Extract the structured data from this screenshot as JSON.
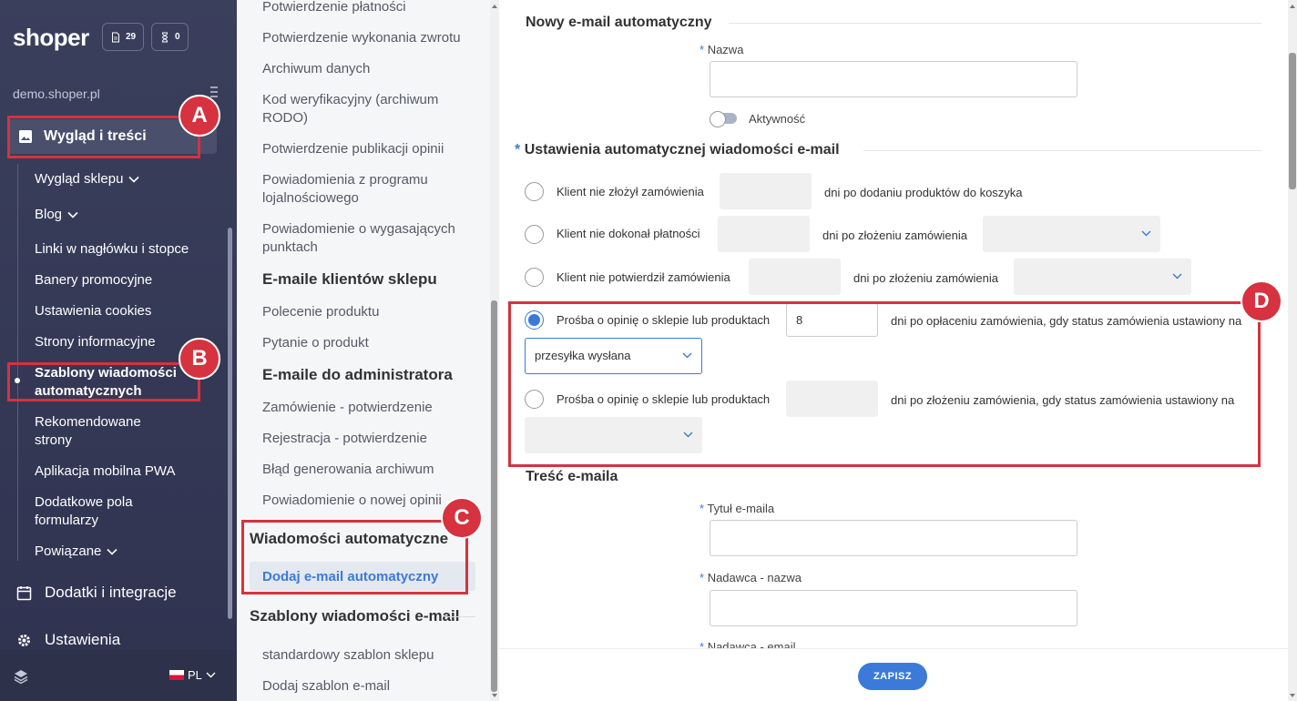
{
  "sidebar": {
    "logo": "shoper",
    "badge_orders": "29",
    "badge_tasks": "0",
    "shop_url": "demo.shoper.pl",
    "active_section": "Wygląd i treści",
    "sub_items": [
      {
        "label": "Wygląd sklepu"
      },
      {
        "label": "Blog"
      },
      {
        "label": "Linki w nagłówku i stopce"
      },
      {
        "label": "Banery promocyjne"
      },
      {
        "label": "Ustawienia cookies"
      },
      {
        "label": "Strony informacyjne"
      },
      {
        "label": "Szablony wiadomości automatycznych"
      },
      {
        "label": "Rekomendowane strony"
      },
      {
        "label": "Aplikacja mobilna PWA"
      },
      {
        "label": "Dodatkowe pola formularzy"
      },
      {
        "label": "Powiązane"
      }
    ],
    "main_items": [
      {
        "label": "Dodatki i integracje",
        "icon": "calendar-icon"
      },
      {
        "label": "Ustawienia",
        "icon": "gear-icon"
      }
    ],
    "language": "PL"
  },
  "middle": {
    "items_top": [
      "Potwierdzenie płatności",
      "Potwierdzenie wykonania zwrotu",
      "Archiwum danych",
      "Kod weryfikacyjny (archiwum RODO)",
      "Potwierdzenie publikacji opinii",
      "Powiadomienia z programu lojalnościowego",
      "Powiadomienie o wygasających punktach"
    ],
    "head_clients": "E-maile klientów sklepu",
    "items_clients": [
      "Polecenie produktu",
      "Pytanie o produkt"
    ],
    "head_admin": "E-maile do administratora",
    "items_admin": [
      "Zamówienie - potwierdzenie",
      "Rejestracja - potwierdzenie",
      "Błąd generowania archiwum",
      "Powiadomienie o nowej opinii"
    ],
    "head_auto": "Wiadomości automatyczne",
    "active_item": "Dodaj e-mail automatyczny",
    "head_templates": "Szablony wiadomości e-mail",
    "items_templates": [
      "standardowy szablon sklepu",
      "Dodaj szablon e-mail"
    ]
  },
  "form": {
    "section_new": "Nowy e-mail automatyczny",
    "name_label": "Nazwa",
    "active_label": "Aktywność",
    "section_settings": "Ustawienia automatycznej wiadomości e-mail",
    "options": [
      {
        "label": "Klient nie złożył zamówienia",
        "suffix": "dni po dodaniu produktów do koszyka",
        "value": ""
      },
      {
        "label": "Klient nie dokonał płatności",
        "suffix": "dni po złożeniu zamówienia",
        "value": ""
      },
      {
        "label": "Klient nie potwierdził zamówienia",
        "suffix": "dni po złożeniu zamówienia",
        "value": ""
      },
      {
        "label": "Prośba o opinię o sklepie lub produktach",
        "suffix": "dni po opłaceniu zamówienia, gdy status zamówienia ustawiony na",
        "value": "8",
        "status": "przesyłka wysłana"
      },
      {
        "label": "Prośba o opinię o sklepie lub produktach",
        "suffix": "dni po złożeniu zamówienia, gdy status zamówienia ustawiony na",
        "value": ""
      }
    ],
    "section_content": "Treść e-maila",
    "subject_label": "Tytuł e-maila",
    "sender_name_label": "Nadawca - nazwa",
    "sender_email_label": "Nadawca - email",
    "required_mark": "*"
  },
  "markers": {
    "a": "A",
    "b": "B",
    "c": "C",
    "d": "D"
  },
  "footer": {
    "save_label": "ZAPISZ"
  },
  "colors": {
    "accent": "#3b7ad9",
    "highlight": "#d6323f",
    "sidebar": "#3a3f5c"
  }
}
